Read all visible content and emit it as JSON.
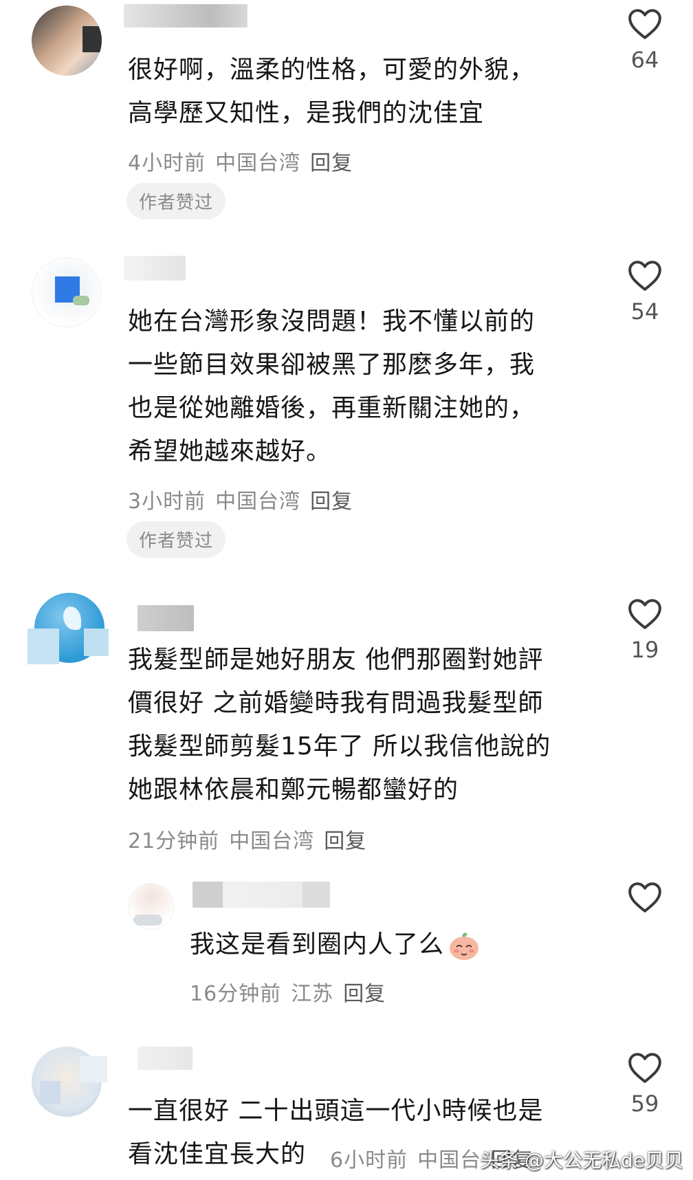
{
  "comments": [
    {
      "text": "很好啊，溫柔的性格，可愛的外貌，\n高學歷又知性，是我們的沈佳宜",
      "time": "4小时前",
      "location": "中国台湾",
      "reply": "回复",
      "badge": "作者赞过",
      "likes": "64"
    },
    {
      "text": "她在台灣形象沒問題！我不懂以前的\n一些節目效果卻被黑了那麽多年，我\n也是從她離婚後，再重新關注她的，\n希望她越來越好。",
      "time": "3小时前",
      "location": "中国台湾",
      "reply": "回复",
      "badge": "作者赞过",
      "likes": "54"
    },
    {
      "text": "我髮型師是她好朋友 他們那圈對她評\n價很好 之前婚變時我有問過我髮型師\n我髮型師剪髮15年了 所以我信他說的\n她跟林依晨和鄭元暢都蠻好的",
      "time": "21分钟前",
      "location": "中国台湾",
      "reply": "回复",
      "likes": "19"
    },
    {
      "text": "我这是看到圈内人了么",
      "time": "16分钟前",
      "location": "江苏",
      "reply": "回复",
      "likes": ""
    },
    {
      "text": "一直很好 二十出頭這一代小時候也是\n看沈佳宜長大的",
      "time": "6小时前",
      "location": "中国台",
      "reply": "回复",
      "likes": "59"
    }
  ],
  "icons": {
    "like": "heart-outline-icon",
    "emoji": "shy-face-emoji-icon"
  },
  "watermark": "头条 @大公无私de贝贝"
}
